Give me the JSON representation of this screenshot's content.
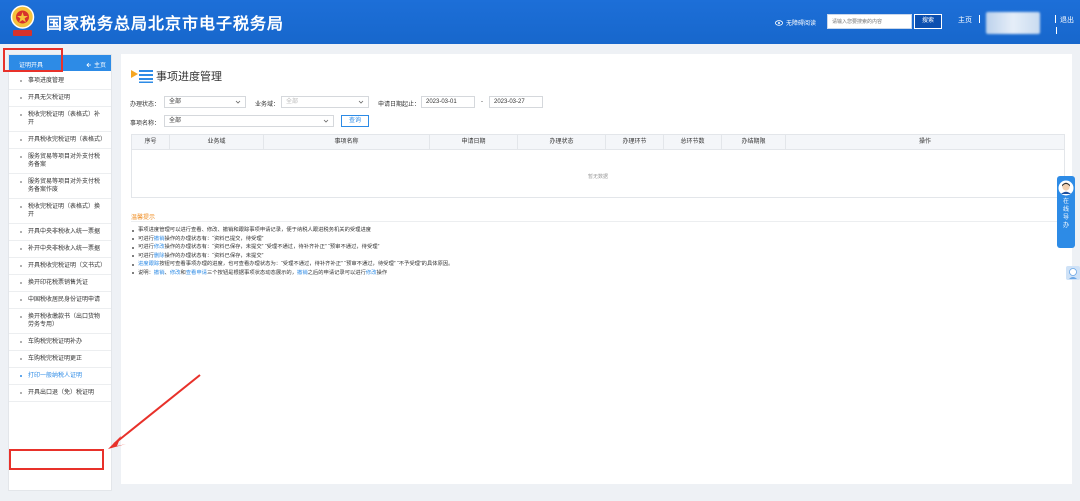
{
  "header": {
    "title": "国家税务总局北京市电子税务局",
    "accessibility": "无障碍阅读",
    "search_placeholder": "请输入您要搜索的内容",
    "search_button": "搜索",
    "home": "主页",
    "logout": "退出"
  },
  "sidebar": {
    "header_label": "证明开具",
    "header_home": "主页",
    "items": [
      "事项进度管理",
      "开具无欠税证明",
      "税收完税证明（表格式）补开",
      "开具税收完税证明（表格式）",
      "服务贸易等项目对外支付税务备案",
      "服务贸易等项目对外支付税务备案作废",
      "税收完税证明（表格式）换开",
      "开具中央非税收入统一票据",
      "补开中央非税收入统一票据",
      "开具税收完税证明（文书式）",
      "换开印花税票销售凭证",
      "中国税收居民身份证明申请",
      "换开税收缴款书（出口货物劳务专用）",
      "车购税完税证明补办",
      "车购税完税证明更正",
      "打印一般纳税人证明",
      "开具出口退（免）税证明"
    ],
    "active_index": 15
  },
  "main": {
    "page_title": "事项进度管理",
    "filters": {
      "status_label": "办理状态：",
      "status_value": "全部",
      "domain_label": "业务域：",
      "domain_value": "全部",
      "date_label": "申请日期起止：",
      "date_start": "2023-03-01",
      "date_sep": "-",
      "date_end": "2023-03-27",
      "item_label": "事项名称：",
      "item_value": "全部",
      "query_button": "查询"
    },
    "table": {
      "columns": [
        "序号",
        "业务域",
        "事项名称",
        "申请日期",
        "办理状态",
        "办理环节",
        "总环节数",
        "办结期限",
        "操作"
      ],
      "empty_text": "暂无数据"
    },
    "tips": {
      "title": "温馨提示",
      "line1": "事项进度管理可以进行查看、修改、撤销和跟踪事项申请记录，便于纳税人跟进税务机关的受理进度",
      "line2_pre": "可进行",
      "line2_hl": "撤销",
      "line2_post": "操作的办理状态有：“资料已提交，待受理”",
      "line3_pre": "可进行",
      "line3_hl": "修改",
      "line3_post": "操作的办理状态有：“资料已保存，未提交” “受理不通过，待补齐补正” “预审不通过，待受理”",
      "line4_pre": "可进行",
      "line4_hl": "删除",
      "line4_post": "操作的办理状态有：“资料已保存，未提交”",
      "line5_hl": "进度跟踪",
      "line5_post": "按钮可查看事项办理的进度，也可查看办理状态为：“受理不通过，待补齐补正” “预审不通过，待受理” “不予受理”的具体原因。",
      "line6_pre": "说明：",
      "line6_hl1": "撤销",
      "line6_sep1": "、",
      "line6_hl2": "修改",
      "line6_mid": "和",
      "line6_hl3": "查看申请",
      "line6_mid2": "三个按钮是根据事项状态动态展示的，",
      "line6_hl4": "撤销",
      "line6_mid3": "之后的申请记录可以进行",
      "line6_hl5": "修改",
      "line6_post": "操作"
    }
  },
  "float_service": {
    "label_chars": [
      "在",
      "线",
      "导",
      "办"
    ]
  },
  "colors": {
    "header_blue": "#1d6fd8",
    "accent_blue": "#2d8be6",
    "annotation_red": "#e8312a",
    "tip_orange": "#f08c1f"
  }
}
